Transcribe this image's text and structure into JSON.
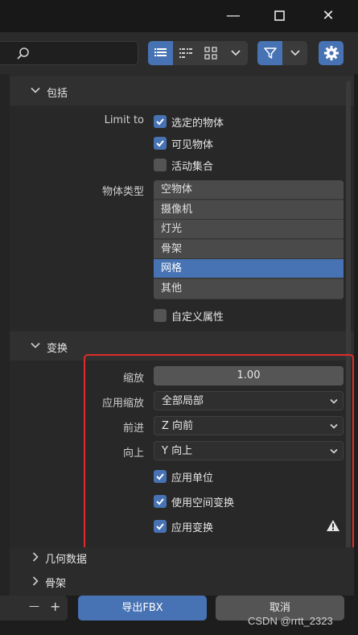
{
  "window": {
    "minimize": "—",
    "close": "✕"
  },
  "toolbar": {
    "search_placeholder": "",
    "icons": [
      "search-icon",
      "list-view-icon",
      "short-list-icon",
      "thumbnail-icon",
      "chevron-down-icon",
      "filter-icon",
      "gear-icon"
    ]
  },
  "include": {
    "title": "包括",
    "limit_to_label": "Limit to",
    "checks": [
      {
        "label": "选定的物体",
        "checked": true
      },
      {
        "label": "可见物体",
        "checked": true
      },
      {
        "label": "活动集合",
        "checked": false
      }
    ],
    "object_types_label": "物体类型",
    "object_types": [
      {
        "label": "空物体",
        "selected": false
      },
      {
        "label": "摄像机",
        "selected": false
      },
      {
        "label": "灯光",
        "selected": false
      },
      {
        "label": "骨架",
        "selected": false
      },
      {
        "label": "网格",
        "selected": true
      },
      {
        "label": "其他",
        "selected": false
      }
    ],
    "custom_props": {
      "label": "自定义属性",
      "checked": false
    }
  },
  "transform": {
    "title": "变换",
    "scale_label": "缩放",
    "scale_value": "1.00",
    "apply_scale_label": "应用缩放",
    "apply_scale_value": "全部局部",
    "forward_label": "前进",
    "forward_value": "Z 向前",
    "up_label": "向上",
    "up_value": "Y 向上",
    "checks": [
      {
        "label": "应用单位",
        "checked": true
      },
      {
        "label": "使用空间变换",
        "checked": true
      },
      {
        "label": "应用变换",
        "checked": true
      }
    ]
  },
  "collapsed_sections": [
    "几何数据",
    "骨架"
  ],
  "footer": {
    "stepper_minus": "—",
    "stepper_plus": "+",
    "export_label": "导出FBX",
    "cancel_label": "取消"
  },
  "watermark": "CSDN @rrtt_2323",
  "colors": {
    "accent": "#4772b3",
    "highlight_box": "#e12b2b",
    "panel": "#2b2b2b"
  }
}
